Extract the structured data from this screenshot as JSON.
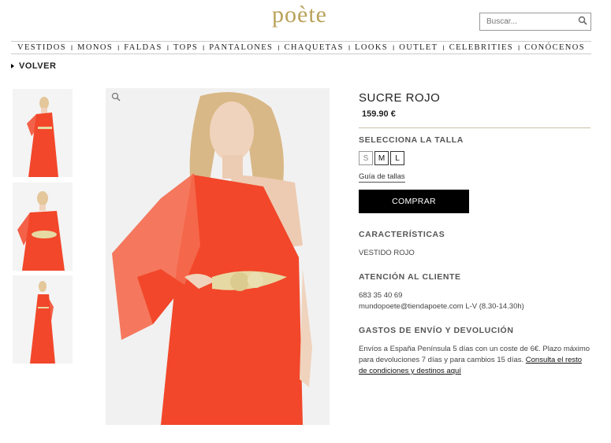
{
  "brand": {
    "logo_text": "poète"
  },
  "search": {
    "placeholder": "Buscar..."
  },
  "nav": {
    "items": [
      "VESTIDOS",
      "MONOS",
      "FALDAS",
      "TOPS",
      "PANTALONES",
      "CHAQUETAS",
      "LOOKS",
      "OUTLET",
      "CELEBRITIES",
      "CONÓCENOS"
    ],
    "separator": "I"
  },
  "back_label": "VOLVER",
  "product": {
    "name": "SUCRE ROJO",
    "price": "159.90 €",
    "dress_color": "#f2472a",
    "belt_color": "#e7d9a3"
  },
  "size_section": {
    "title": "SELECCIONA LA TALLA",
    "sizes": [
      "S",
      "M",
      "L"
    ],
    "guide_label": "Guía de tallas"
  },
  "buy_label": "COMPRAR",
  "features": {
    "title": "CARACTERÍSTICAS",
    "text": "VESTIDO ROJO"
  },
  "support": {
    "title": "ATENCIÓN AL CLIENTE",
    "phone": "683 35 40 69",
    "email_hours": "mundopoete@tiendapoete.com L-V (8.30-14.30h)"
  },
  "shipping": {
    "title": "GASTOS DE ENVÍO Y DEVOLUCIÓN",
    "text": "Envíos a España Península 5 días con un coste de 6€. Plazo máximo para devoluciones 7 días y para cambios 15 días.",
    "link_label": "Consulta el resto de condiciones y destinos aquí"
  },
  "icons": {
    "search": "search-icon",
    "zoom": "magnifier-icon",
    "back": "arrow-right-icon"
  }
}
